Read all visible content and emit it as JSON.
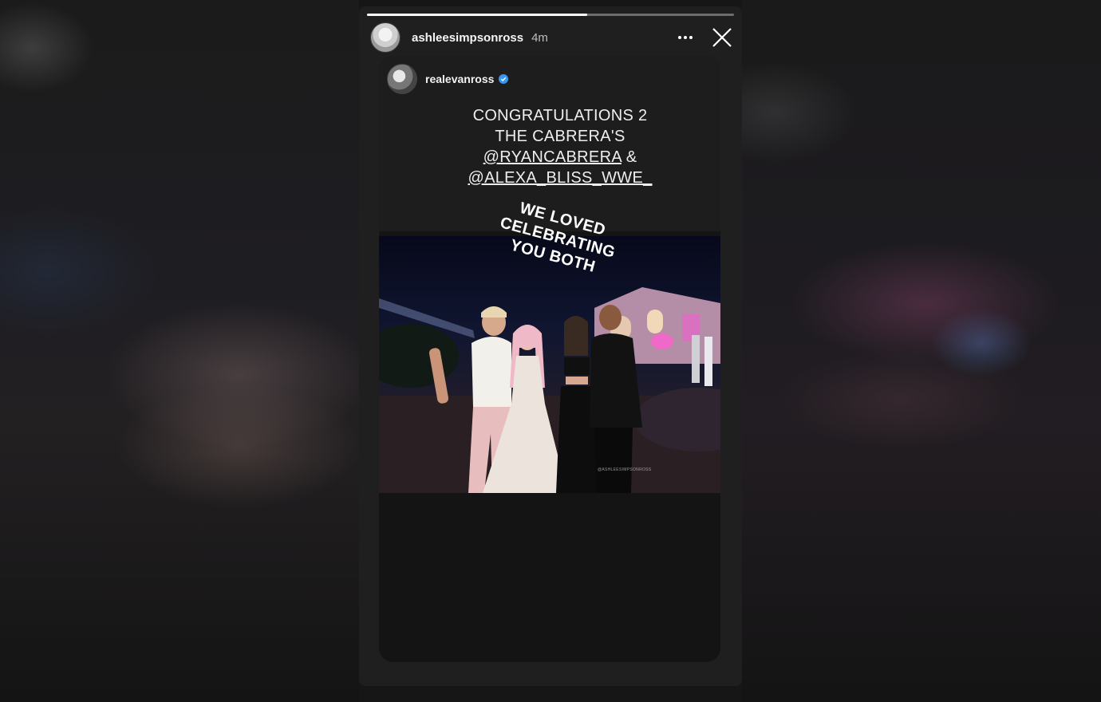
{
  "story": {
    "username": "ashleesimpsonross",
    "time_ago": "4m",
    "progress": 0.6
  },
  "post": {
    "username": "realevanross",
    "verified": true,
    "caption_lines": [
      {
        "text": "CONGRATULATIONS 2",
        "mention": false
      },
      {
        "text": "THE CABRERA'S",
        "mention": false
      },
      {
        "text": "@RYANCABRERA",
        "suffix": " &",
        "mention": true
      },
      {
        "text": "@ALEXA_BLISS_WWE_",
        "mention": true
      }
    ],
    "rotated_caption_lines": [
      "WE LOVED CELEBRATING",
      "YOU BOTH"
    ],
    "watermark": "@ASHLEESIMPSONROSS"
  },
  "icons": {
    "more": "more-horizontal-icon",
    "close": "close-icon",
    "verified": "verified-badge-icon"
  },
  "colors": {
    "verified": "#3797f0",
    "story_bg": "#1f1f1f",
    "card_bg": "#141414"
  }
}
